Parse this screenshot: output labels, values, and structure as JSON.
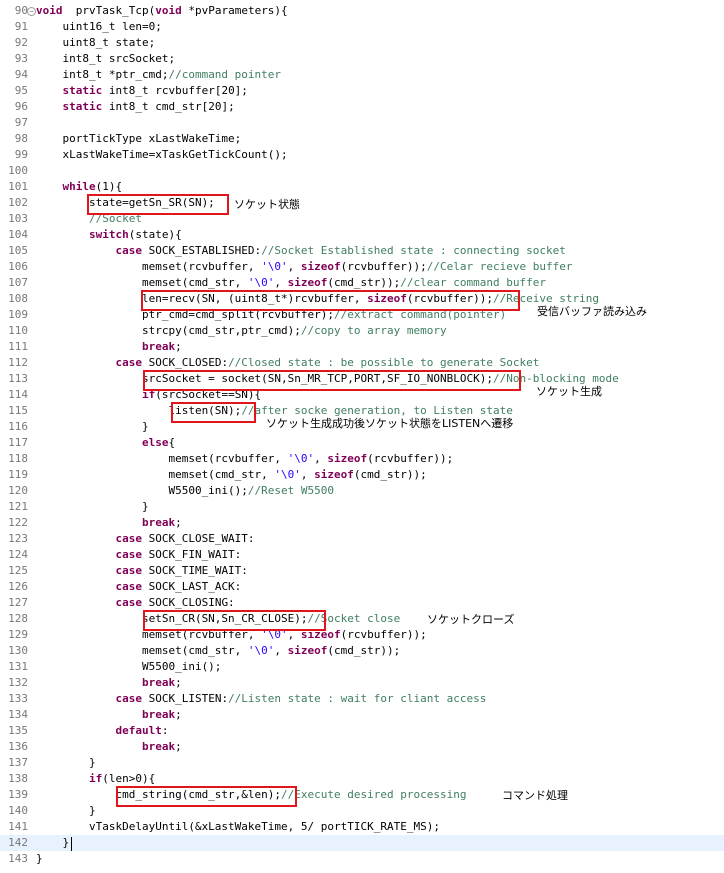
{
  "editor": {
    "current_line": 142,
    "lines": [
      {
        "n": "90",
        "fold": "−",
        "t": [
          [
            "kw",
            "void"
          ],
          [
            "",
            "  prvTask_Tcp("
          ],
          [
            "kw",
            "void"
          ],
          [
            "",
            " *pvParameters){"
          ]
        ]
      },
      {
        "n": "91",
        "t": [
          [
            "",
            "    uint16_t len=0;"
          ]
        ]
      },
      {
        "n": "92",
        "t": [
          [
            "",
            "    uint8_t state;"
          ]
        ]
      },
      {
        "n": "93",
        "t": [
          [
            "",
            "    int8_t srcSocket;"
          ]
        ]
      },
      {
        "n": "94",
        "t": [
          [
            "",
            "    int8_t *ptr_cmd;"
          ],
          [
            "cm",
            "//command pointer"
          ]
        ]
      },
      {
        "n": "95",
        "t": [
          [
            "kw",
            "    static"
          ],
          [
            "",
            " int8_t rcvbuffer[20];"
          ]
        ]
      },
      {
        "n": "96",
        "t": [
          [
            "kw",
            "    static"
          ],
          [
            "",
            " int8_t cmd_str[20];"
          ]
        ]
      },
      {
        "n": "97",
        "t": []
      },
      {
        "n": "98",
        "t": [
          [
            "",
            "    portTickType xLastWakeTime;"
          ]
        ]
      },
      {
        "n": "99",
        "t": [
          [
            "",
            "    xLastWakeTime=xTaskGetTickCount();"
          ]
        ]
      },
      {
        "n": "100",
        "t": []
      },
      {
        "n": "101",
        "t": [
          [
            "kw",
            "    while"
          ],
          [
            "",
            "(1){"
          ]
        ]
      },
      {
        "n": "102",
        "t": [
          [
            "",
            "        state=getSn_SR(SN);"
          ]
        ]
      },
      {
        "n": "103",
        "t": [
          [
            "cm",
            "        //Socket"
          ]
        ]
      },
      {
        "n": "104",
        "t": [
          [
            "kw",
            "        switch"
          ],
          [
            "",
            "(state){"
          ]
        ]
      },
      {
        "n": "105",
        "t": [
          [
            "kw",
            "            case"
          ],
          [
            "",
            " SOCK_ESTABLISHED:"
          ],
          [
            "cm",
            "//Socket Established state : connecting socket"
          ]
        ]
      },
      {
        "n": "106",
        "t": [
          [
            "",
            "                memset(rcvbuffer, "
          ],
          [
            "str",
            "'\\0'"
          ],
          [
            "",
            ", "
          ],
          [
            "kw",
            "sizeof"
          ],
          [
            "",
            "(rcvbuffer));"
          ],
          [
            "cm",
            "//Celar recieve buffer"
          ]
        ]
      },
      {
        "n": "107",
        "t": [
          [
            "",
            "                memset(cmd_str, "
          ],
          [
            "str",
            "'\\0'"
          ],
          [
            "",
            ", "
          ],
          [
            "kw",
            "sizeof"
          ],
          [
            "",
            "(cmd_str));"
          ],
          [
            "cm",
            "//clear command buffer"
          ]
        ]
      },
      {
        "n": "108",
        "t": [
          [
            "",
            "                len=recv(SN, (uint8_t*)rcvbuffer, "
          ],
          [
            "kw",
            "sizeof"
          ],
          [
            "",
            "(rcvbuffer));"
          ],
          [
            "cm",
            "//Receive string"
          ]
        ]
      },
      {
        "n": "109",
        "t": [
          [
            "",
            "                ptr_cmd=cmd_split(rcvbuffer);"
          ],
          [
            "cm",
            "//extract command(pointer)"
          ]
        ]
      },
      {
        "n": "110",
        "t": [
          [
            "",
            "                strcpy(cmd_str,ptr_cmd);"
          ],
          [
            "cm",
            "//copy to array memory"
          ]
        ]
      },
      {
        "n": "111",
        "t": [
          [
            "kw",
            "                break"
          ],
          [
            "",
            ";"
          ]
        ]
      },
      {
        "n": "112",
        "t": [
          [
            "kw",
            "            case"
          ],
          [
            "",
            " SOCK_CLOSED:"
          ],
          [
            "cm",
            "//Closed state : be possible to generate Socket"
          ]
        ]
      },
      {
        "n": "113",
        "t": [
          [
            "",
            "                srcSocket = socket(SN,Sn_MR_TCP,PORT,SF_IO_NONBLOCK);"
          ],
          [
            "cm",
            "//Non-blocking mode"
          ]
        ]
      },
      {
        "n": "114",
        "t": [
          [
            "kw",
            "                if"
          ],
          [
            "",
            "(srcSocket==SN){"
          ]
        ]
      },
      {
        "n": "115",
        "t": [
          [
            "",
            "                    listen(SN);"
          ],
          [
            "cm",
            "//after socke generation, to Listen state"
          ]
        ]
      },
      {
        "n": "116",
        "t": [
          [
            "",
            "                }"
          ]
        ]
      },
      {
        "n": "117",
        "t": [
          [
            "kw",
            "                else"
          ],
          [
            "",
            "{"
          ]
        ]
      },
      {
        "n": "118",
        "t": [
          [
            "",
            "                    memset(rcvbuffer, "
          ],
          [
            "str",
            "'\\0'"
          ],
          [
            "",
            ", "
          ],
          [
            "kw",
            "sizeof"
          ],
          [
            "",
            "(rcvbuffer));"
          ]
        ]
      },
      {
        "n": "119",
        "t": [
          [
            "",
            "                    memset(cmd_str, "
          ],
          [
            "str",
            "'\\0'"
          ],
          [
            "",
            ", "
          ],
          [
            "kw",
            "sizeof"
          ],
          [
            "",
            "(cmd_str));"
          ]
        ]
      },
      {
        "n": "120",
        "t": [
          [
            "",
            "                    W5500_ini();"
          ],
          [
            "cm",
            "//Reset W5500"
          ]
        ]
      },
      {
        "n": "121",
        "t": [
          [
            "",
            "                }"
          ]
        ]
      },
      {
        "n": "122",
        "t": [
          [
            "kw",
            "                break"
          ],
          [
            "",
            ";"
          ]
        ]
      },
      {
        "n": "123",
        "t": [
          [
            "kw",
            "            case"
          ],
          [
            "",
            " SOCK_CLOSE_WAIT:"
          ]
        ]
      },
      {
        "n": "124",
        "t": [
          [
            "kw",
            "            case"
          ],
          [
            "",
            " SOCK_FIN_WAIT:"
          ]
        ]
      },
      {
        "n": "125",
        "t": [
          [
            "kw",
            "            case"
          ],
          [
            "",
            " SOCK_TIME_WAIT:"
          ]
        ]
      },
      {
        "n": "126",
        "t": [
          [
            "kw",
            "            case"
          ],
          [
            "",
            " SOCK_LAST_ACK:"
          ]
        ]
      },
      {
        "n": "127",
        "t": [
          [
            "kw",
            "            case"
          ],
          [
            "",
            " SOCK_CLOSING:"
          ]
        ]
      },
      {
        "n": "128",
        "t": [
          [
            "",
            "                setSn_CR(SN,Sn_CR_CLOSE);"
          ],
          [
            "cm",
            "//Socket close"
          ]
        ]
      },
      {
        "n": "129",
        "t": [
          [
            "",
            "                memset(rcvbuffer, "
          ],
          [
            "str",
            "'\\0'"
          ],
          [
            "",
            ", "
          ],
          [
            "kw",
            "sizeof"
          ],
          [
            "",
            "(rcvbuffer));"
          ]
        ]
      },
      {
        "n": "130",
        "t": [
          [
            "",
            "                memset(cmd_str, "
          ],
          [
            "str",
            "'\\0'"
          ],
          [
            "",
            ", "
          ],
          [
            "kw",
            "sizeof"
          ],
          [
            "",
            "(cmd_str));"
          ]
        ]
      },
      {
        "n": "131",
        "t": [
          [
            "",
            "                W5500_ini();"
          ]
        ]
      },
      {
        "n": "132",
        "t": [
          [
            "kw",
            "                break"
          ],
          [
            "",
            ";"
          ]
        ]
      },
      {
        "n": "133",
        "t": [
          [
            "kw",
            "            case"
          ],
          [
            "",
            " SOCK_LISTEN:"
          ],
          [
            "cm",
            "//Listen state : wait for cliant access"
          ]
        ]
      },
      {
        "n": "134",
        "t": [
          [
            "kw",
            "                break"
          ],
          [
            "",
            ";"
          ]
        ]
      },
      {
        "n": "135",
        "t": [
          [
            "kw",
            "            default"
          ],
          [
            "",
            ":"
          ]
        ]
      },
      {
        "n": "136",
        "t": [
          [
            "kw",
            "                break"
          ],
          [
            "",
            ";"
          ]
        ]
      },
      {
        "n": "137",
        "t": [
          [
            "",
            "        }"
          ]
        ]
      },
      {
        "n": "138",
        "t": [
          [
            "kw",
            "        if"
          ],
          [
            "",
            "(len>0){"
          ]
        ]
      },
      {
        "n": "139",
        "t": [
          [
            "",
            "            cmd_string(cmd_str,&len);"
          ],
          [
            "cm",
            "//Execute desired processing"
          ]
        ]
      },
      {
        "n": "140",
        "t": [
          [
            "",
            "        }"
          ]
        ]
      },
      {
        "n": "141",
        "t": [
          [
            "",
            "        vTaskDelayUntil(&xLastWakeTime, 5/ portTICK_RATE_MS);"
          ]
        ]
      },
      {
        "n": "142",
        "t": [
          [
            "",
            "    }"
          ]
        ]
      },
      {
        "n": "143",
        "t": [
          [
            "",
            "}"
          ]
        ]
      }
    ]
  },
  "annotations": {
    "a102": "ソケット状態",
    "a109": "受信バッファ読み込み",
    "a114": "ソケット生成",
    "a116": "ソケット生成成功後ソケット状態をLISTENへ遷移",
    "a128": "ソケットクローズ",
    "a139": "コマンド処理"
  },
  "colors": {
    "keyword": "#7f0055",
    "comment": "#3f7f5f",
    "string": "#2a00ff",
    "highlight_box": "#e0161c",
    "current_line_bg": "#e8f2fe"
  }
}
